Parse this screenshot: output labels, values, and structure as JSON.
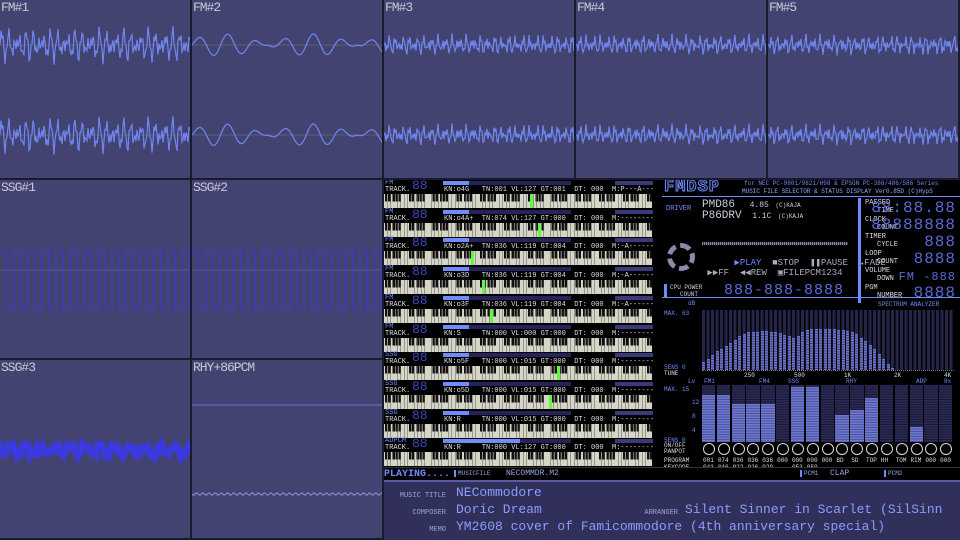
{
  "waves": [
    {
      "label": "FM#1",
      "kind": "fm1"
    },
    {
      "label": "FM#2",
      "kind": "fm2"
    },
    {
      "label": "FM#3",
      "kind": "fm3"
    },
    {
      "label": "FM#4",
      "kind": "fm3"
    },
    {
      "label": "FM#5",
      "kind": "fm3"
    },
    {
      "label": "SSG#1",
      "kind": "sq"
    },
    {
      "label": "SSG#2",
      "kind": "sq"
    },
    {
      "label": "SSG#3",
      "kind": "noise"
    },
    {
      "label": "RHY+86PCM",
      "kind": "pcm"
    }
  ],
  "colors": {
    "fm_wave": "#6f86f0",
    "ssg_wave": "#3a3ae0",
    "accent": "#6f8cff",
    "note": "#5cff3a",
    "panel": "#434372"
  },
  "tracks": [
    {
      "type": "FM",
      "label": "TRACK.",
      "num": "88",
      "kn": "o4G",
      "tn": "001",
      "vl": "127",
      "gt": "001",
      "dt": "000",
      "m": "P---A---",
      "level": 0.2
    },
    {
      "type": "FM",
      "label": "TRACK.",
      "num": "88",
      "kn": "o4A+",
      "tn": "074",
      "vl": "127",
      "gt": "000",
      "dt": "000",
      "m": "--------",
      "level": 0.2
    },
    {
      "type": "FM",
      "label": "TRACK.",
      "num": "88",
      "kn": "o2A+",
      "tn": "036",
      "vl": "119",
      "gt": "004",
      "dt": "000",
      "m": "-A------",
      "level": 0.2
    },
    {
      "type": "FM",
      "label": "TRACK.",
      "num": "88",
      "kn": "o3D",
      "tn": "036",
      "vl": "119",
      "gt": "004",
      "dt": "000",
      "m": "-A------",
      "level": 0.2
    },
    {
      "type": "FM",
      "label": "TRACK.",
      "num": "88",
      "kn": "o3F",
      "tn": "036",
      "vl": "119",
      "gt": "004",
      "dt": "000",
      "m": "-A------",
      "level": 0.2
    },
    {
      "type": "FM",
      "label": "TRACK.",
      "num": "88",
      "kn": "S",
      "tn": "000",
      "vl": "000",
      "gt": "000",
      "dt": "000",
      "m": "--------",
      "level": 0.2
    },
    {
      "type": "SSG",
      "label": "TRACK.",
      "num": "88",
      "kn": "o5F",
      "tn": "000",
      "vl": "015",
      "gt": "000",
      "dt": "000",
      "m": "--------",
      "level": 0.2
    },
    {
      "type": "SSG",
      "label": "TRACK.",
      "num": "88",
      "kn": "o5D",
      "tn": "000",
      "vl": "015",
      "gt": "000",
      "dt": "000",
      "m": "--------",
      "level": 0.2
    },
    {
      "type": "SSG",
      "label": "TRACK.",
      "num": "88",
      "kn": "R",
      "tn": "000",
      "vl": "015",
      "gt": "000",
      "dt": "000",
      "m": "--------",
      "level": 0.2
    },
    {
      "type": "ADPCM",
      "label": "TRACK.",
      "num": "88",
      "kn": "R",
      "tn": "000",
      "vl": "127",
      "gt": "000",
      "dt": "000",
      "m": "--------",
      "level": 0.6
    }
  ],
  "header": {
    "logo": "FMDSP",
    "line1": "for NEC PC-9801/9821/H98 & EPSON PC-386/486/586 Series",
    "line2": "MUSIC FILE SELECTOR & STATUS DISPLAY Ver0.85D (C)HypS"
  },
  "driver": {
    "label": "DRIVER",
    "name1": "PMD86",
    "ver1": "4.85",
    "copy1": "(C)KAJA",
    "name2": "P86DRV",
    "ver2": "1.1C",
    "copy2": "(C)KAJA"
  },
  "controls": {
    "play": "PLAY",
    "stop": "STOP",
    "pause": "PAUSE",
    "fade": "FADE",
    "ff": "FF",
    "rew": "REW",
    "filepcm": "FILEPCM1234"
  },
  "cpu": {
    "label1": "CPU POWER",
    "label2": "COUNT",
    "value": "888-888-8888"
  },
  "status": [
    {
      "k1": "PASSED",
      "k2": "TIME",
      "v": "88:88.88"
    },
    {
      "k1": "CLOCK",
      "k2": "COUNT",
      "v": "88888888"
    },
    {
      "k1": "TIMER",
      "k2": "CYCLE",
      "v": "888"
    },
    {
      "k1": "LOOP",
      "k2": "COUNT",
      "v": "8888"
    },
    {
      "k1": "VOLUME",
      "k2": "DOWN",
      "v": "FM -888"
    },
    {
      "k1": "PGM",
      "k2": "NUMBER",
      "v": "8888"
    }
  ],
  "spectrum": {
    "title": "SPECTRUM ANALYZER",
    "unit": "dB",
    "max": "MAX. 63",
    "sens": "SENS 0",
    "tune": "TUNE",
    "ticks": [
      "250",
      "500",
      "1K",
      "2K",
      "4K"
    ],
    "values": [
      8,
      12,
      16,
      20,
      22,
      25,
      28,
      32,
      36,
      38,
      40,
      40,
      40,
      41,
      41,
      40,
      40,
      39,
      37,
      36,
      34,
      36,
      40,
      42,
      43,
      43,
      43,
      43,
      43,
      43,
      42,
      42,
      41,
      40,
      38,
      34,
      30,
      26,
      22,
      17,
      12,
      6,
      2,
      0,
      0,
      0,
      0,
      0,
      0,
      0,
      0,
      0,
      0,
      0,
      0,
      0
    ]
  },
  "levels": {
    "unit": "Lv",
    "max": "MAX. 15",
    "ticks": [
      "12",
      "8",
      "4"
    ],
    "sens": "SENS 0",
    "groups": [
      "FM1",
      "FM4",
      "SSG",
      "RHY",
      "ADP",
      "8x"
    ],
    "values": [
      12.5,
      12.5,
      10,
      10,
      10,
      0,
      14.5,
      14.5,
      0,
      7,
      8.5,
      11.5,
      0,
      0,
      4,
      0,
      0
    ]
  },
  "rows": {
    "onoff": "ON/OFF",
    "panpot": "PANPOT",
    "program": "PROGRAM",
    "keycode": "KEYCODE",
    "programs": [
      "001",
      "074",
      "036",
      "036",
      "036",
      "000",
      "000",
      "000",
      "000",
      "BD",
      "SD",
      "TOP",
      "HH",
      "TOM",
      "RIM",
      "000",
      "000"
    ],
    "keycodes": [
      "043",
      "046",
      "022",
      "026",
      "029",
      "---",
      "053",
      "050",
      "---",
      "---",
      "---",
      "---",
      "---",
      "---",
      "---",
      "---",
      "---"
    ]
  },
  "playbar": {
    "status": "PLAYING....",
    "file_label": "MUSICFILE",
    "file": "NECOMMDR.M2",
    "pcm1_label": "PCM1",
    "pcm1": "CLAP",
    "pcm2_label": "PCM2"
  },
  "info": {
    "title_label": "MUSIC TITLE",
    "title": "NECommodore",
    "composer_label": "COMPOSER",
    "composer": "Doric Dream",
    "arranger_label": "ARRANGER",
    "arranger": "Silent Sinner in Scarlet (SilSinn",
    "memo_label": "MEMO",
    "memo": "YM2608 cover of Famicommodore (4th anniversary special)"
  }
}
